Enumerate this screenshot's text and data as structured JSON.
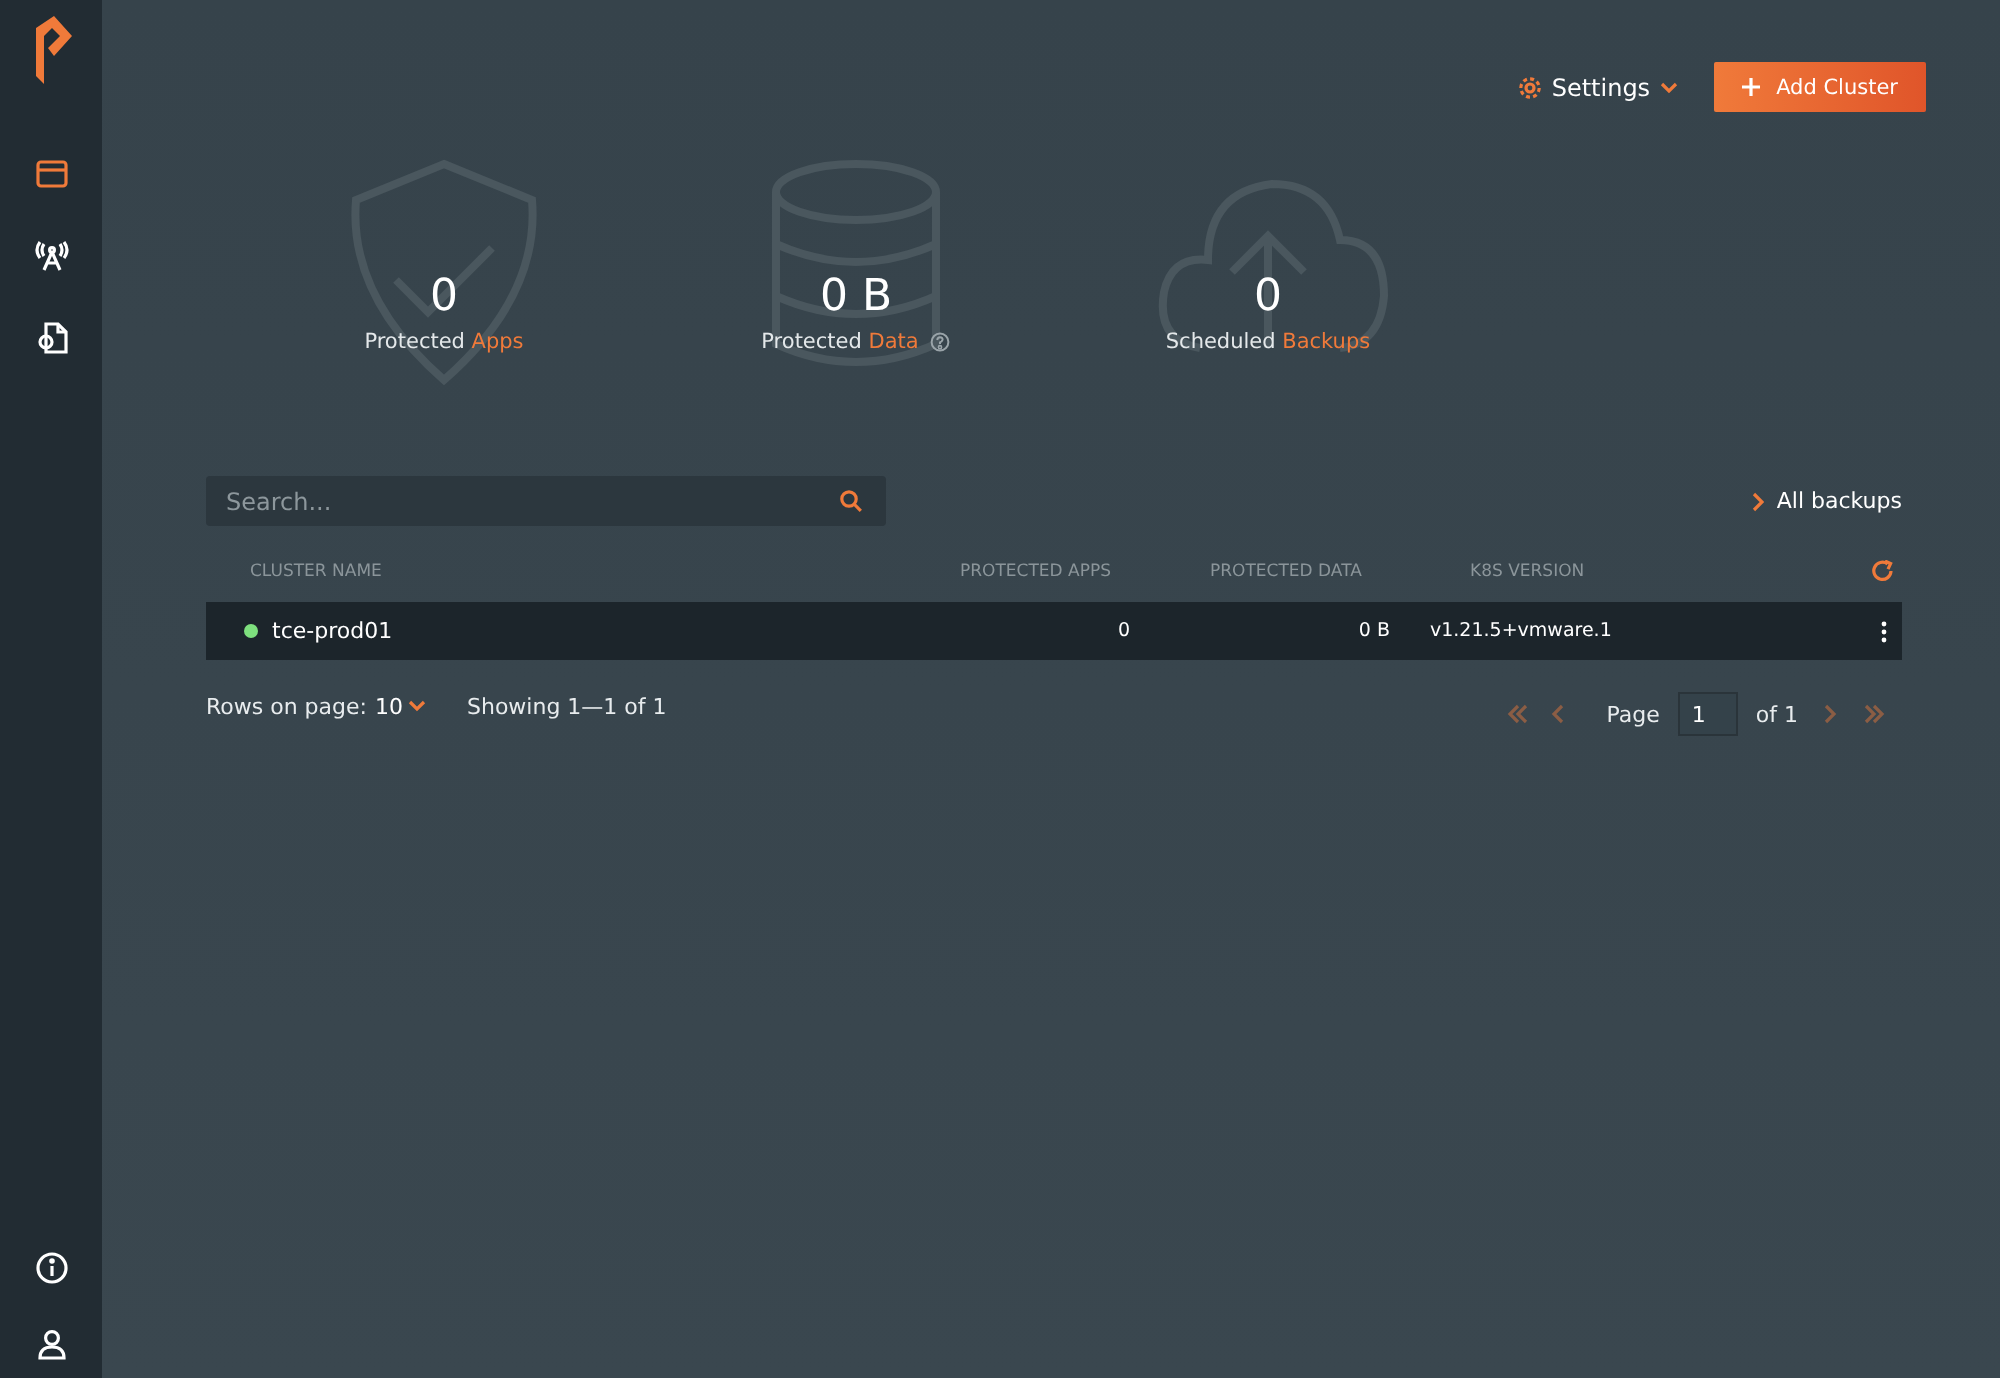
{
  "sidebar": {
    "items": [
      {
        "selected": true
      },
      {
        "selected": false
      },
      {
        "selected": false
      }
    ]
  },
  "header": {
    "settings": "Settings",
    "add_button": "Add Cluster"
  },
  "stats": [
    {
      "value": "0",
      "label": "Protected",
      "highlight": "Apps",
      "help": false
    },
    {
      "value": "0 B",
      "label": "Protected",
      "highlight": "Data",
      "help": true
    },
    {
      "value": "0",
      "label": "Scheduled",
      "highlight": "Backups",
      "help": false
    }
  ],
  "search": {
    "placeholder": "Search..."
  },
  "all_backups_link": "All backups",
  "table": {
    "columns": [
      "CLUSTER NAME",
      "PROTECTED APPS",
      "PROTECTED DATA",
      "K8S VERSION"
    ],
    "rows": [
      {
        "name": "tce-prod01",
        "color": "#7ee07e",
        "apps": "0",
        "data": "0 B",
        "version": "v1.21.5+vmware.1"
      }
    ]
  },
  "footer": {
    "rows_label": "Rows on page:",
    "rows_value": "10",
    "showing": "Showing 1—1 of 1",
    "page_label": "Page",
    "page_value": "1",
    "of": "of 1",
    "nav": [
      {
        "kind": "first",
        "disabled": true
      },
      {
        "kind": "prev",
        "disabled": true
      },
      {
        "kind": "next",
        "disabled": true
      },
      {
        "kind": "last",
        "disabled": true
      }
    ]
  }
}
